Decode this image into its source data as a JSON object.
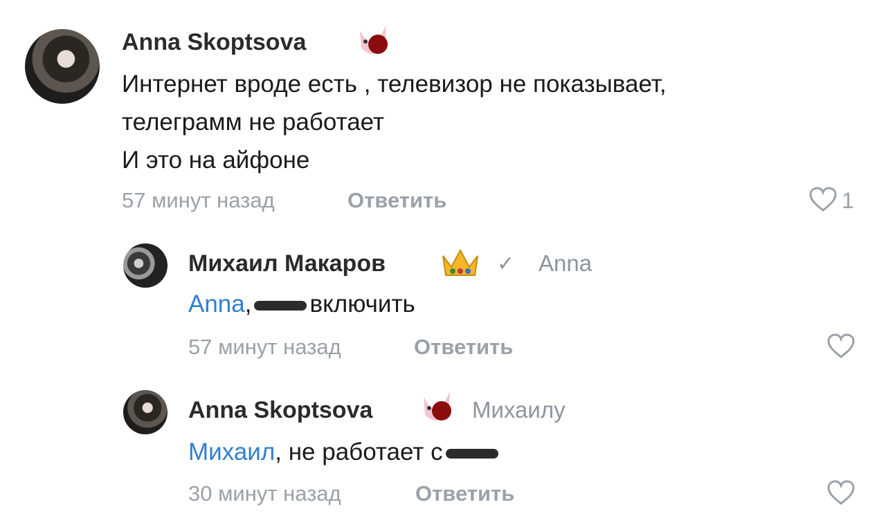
{
  "comments": [
    {
      "author": "Anna Skoptsova",
      "lines": [
        "Интернет вроде есть , телевизор не показывает,",
        "телеграмм не работает",
        "И это на айфоне"
      ],
      "time": "57 минут назад",
      "reply_label": "Ответить",
      "likes": "1"
    },
    {
      "author": "Михаил Макаров",
      "reply_to": "Anna",
      "mention": "Anna",
      "text_after": "включить",
      "time": "57 минут назад",
      "reply_label": "Ответить"
    },
    {
      "author": "Anna Skoptsova",
      "reply_to": "Михаилу",
      "mention": "Михаил",
      "text_after": ", не работает с",
      "time": "30 минут назад",
      "reply_label": "Ответить"
    }
  ],
  "icons": [
    "cat-emoji-icon",
    "crown-emoji-icon",
    "verified-check-icon",
    "heart-icon"
  ],
  "colors": {
    "mention": "#2f7fd1",
    "meta": "#9aa1a9",
    "name": "#2b2b2b"
  }
}
